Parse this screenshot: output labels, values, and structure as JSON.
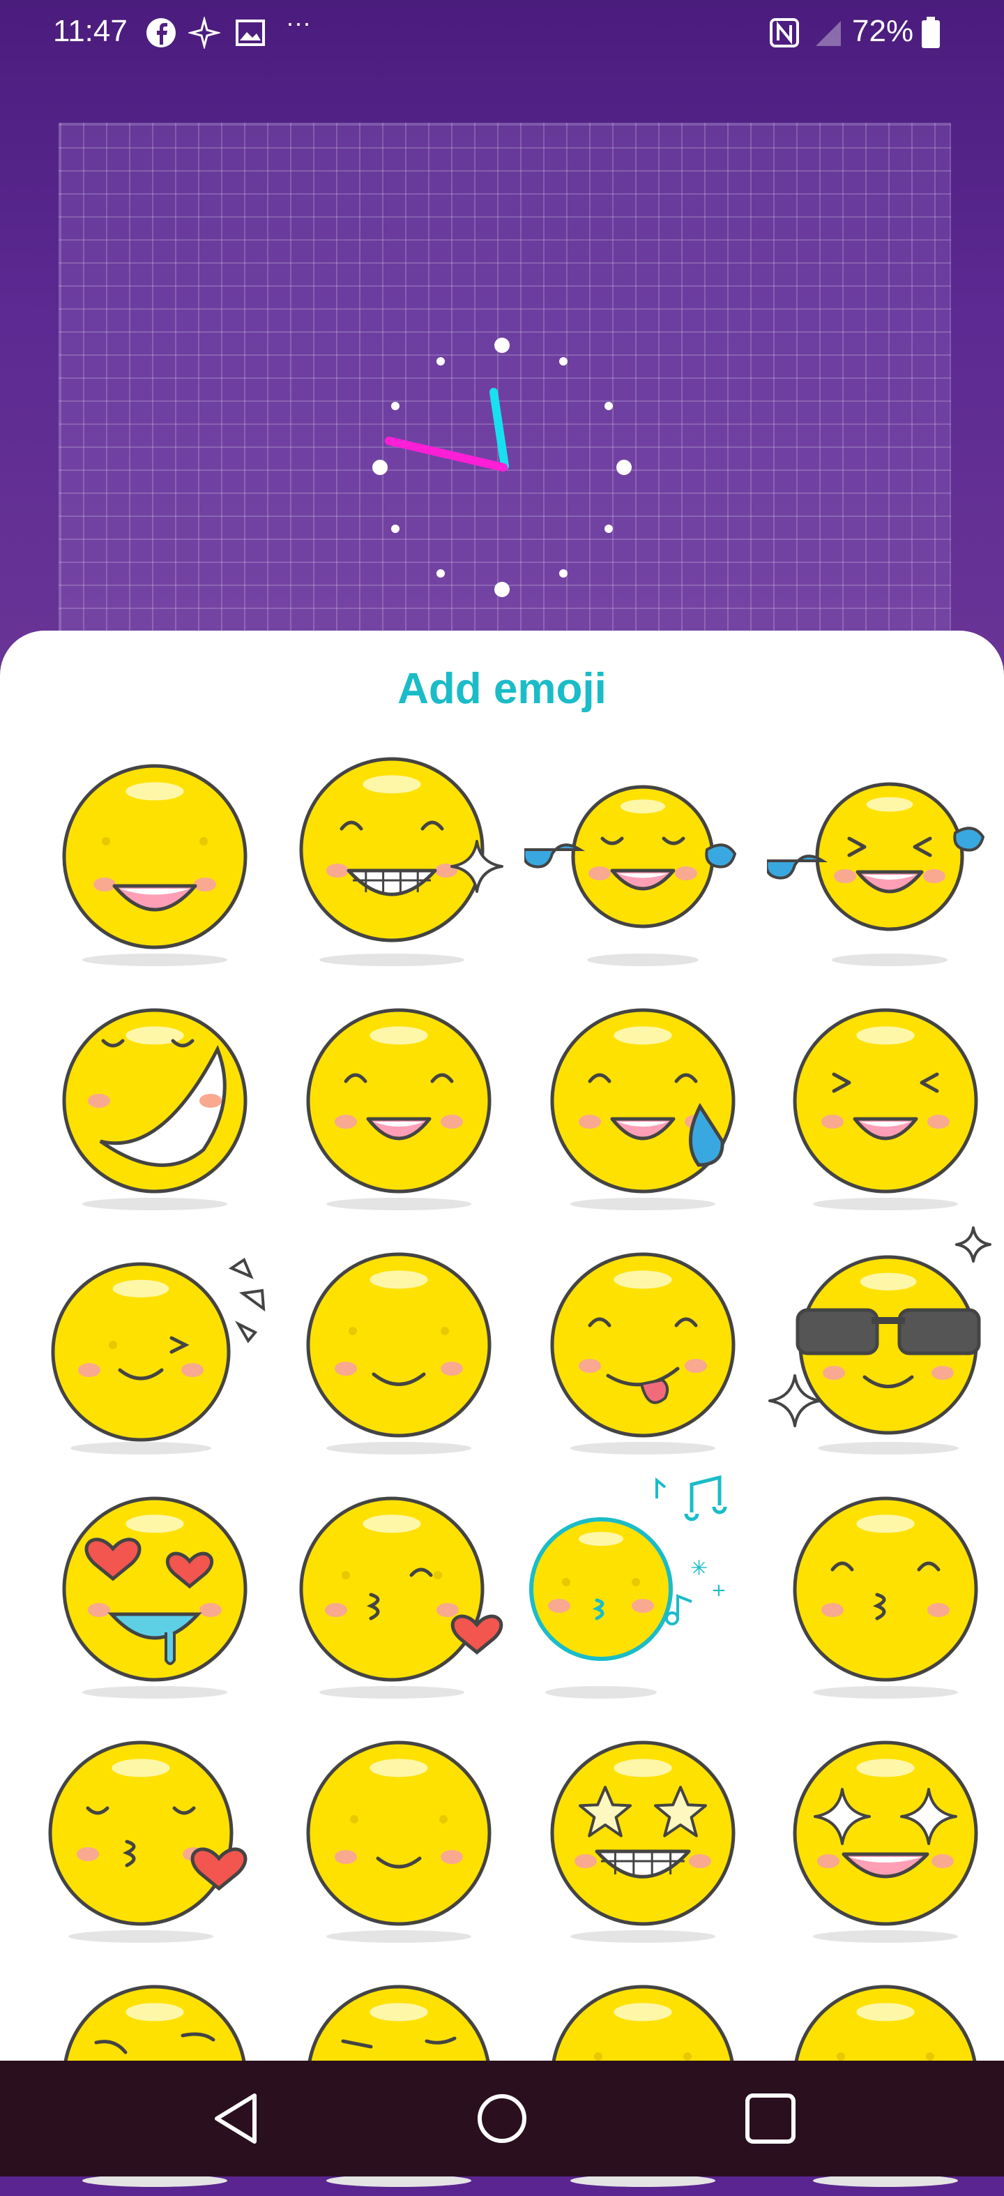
{
  "status_bar": {
    "time": "11:47",
    "icons": [
      "facebook-icon",
      "sparkle-app-icon",
      "gallery-icon",
      "more-notifications-icon",
      "nfc-icon",
      "signal-icon",
      "battery-icon"
    ],
    "more_indicator": "···",
    "battery_percent": "72%"
  },
  "preview": {
    "colors": {
      "background": "#5a2590",
      "minute_hand": "#19e0f0",
      "hour_hand": "#ff1fd6"
    }
  },
  "sheet": {
    "title": "Add emoji",
    "title_color": "#1bbcc8",
    "emojis": [
      {
        "name": "big-smile"
      },
      {
        "name": "grin-sparkle"
      },
      {
        "name": "tears-of-joy"
      },
      {
        "name": "laughing-tears-tilted"
      },
      {
        "name": "rolling-laugh"
      },
      {
        "name": "happy-smile"
      },
      {
        "name": "sweat-smile"
      },
      {
        "name": "squint-laugh"
      },
      {
        "name": "wink-shout"
      },
      {
        "name": "calm-smile"
      },
      {
        "name": "tongue-out"
      },
      {
        "name": "cool-sunglasses"
      },
      {
        "name": "heart-eyes-drool"
      },
      {
        "name": "kiss-heart"
      },
      {
        "name": "whistle-music"
      },
      {
        "name": "kiss-closed-eyes"
      },
      {
        "name": "kiss-heart-closed-eyes"
      },
      {
        "name": "slight-smile"
      },
      {
        "name": "star-eyes-grin"
      },
      {
        "name": "sparkle-eyes-grin"
      },
      {
        "name": "smirk-partial"
      },
      {
        "name": "squint-partial"
      },
      {
        "name": "smile-partial"
      },
      {
        "name": "smile-partial-2"
      }
    ]
  },
  "nav_bar": {
    "buttons": [
      "back-button",
      "home-button",
      "recents-button"
    ]
  }
}
